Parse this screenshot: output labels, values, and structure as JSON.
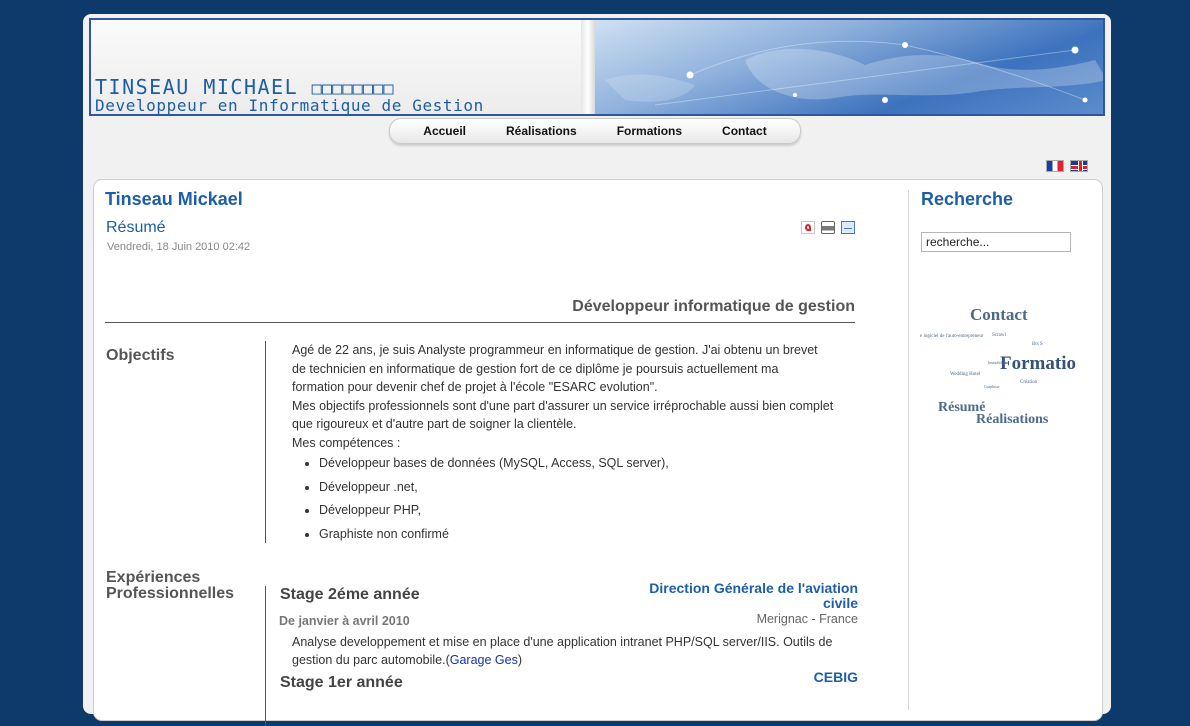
{
  "header": {
    "title": "TINSEAU MICHAEL",
    "title_boxes": "□□□□□□□□",
    "subtitle": "Developpeur en Informatique de Gestion"
  },
  "nav": {
    "items": [
      "Accueil",
      "Réalisations",
      "Formations",
      "Contact"
    ]
  },
  "languages": {
    "fr_icon": "french-flag-icon",
    "en_icon": "english-flag-icon"
  },
  "article": {
    "author": "Tinseau Mickael",
    "title": "Résumé",
    "date": "Vendredi, 18 Juin 2010 02:42",
    "icons": [
      "pdf-icon",
      "print-icon",
      "email-icon"
    ],
    "subheading": "Développeur informatique de gestion",
    "objectives": {
      "label": "Objectifs",
      "lines": [
        "Agé de 22 ans, je suis Analyste programmeur en informatique de gestion. J'ai obtenu un brevet",
        "de technicien en informatique de gestion fort de ce diplôme je poursuis actuellement ma",
        "formation pour devenir chef de projet à l'école \"ESARC evolution\".",
        "Mes objectifs professionnels sont d'une part d'assurer un service irréprochable aussi bien complet",
        "que rigoureux  et d'autre part de soigner la clientèle.",
        "Mes compétences :"
      ],
      "skills": [
        "Développeur bases de données (MySQL, Access, SQL server),",
        "Développeur .net,",
        "Développeur PHP,",
        "Graphiste non confirmé"
      ]
    },
    "experience": {
      "label_line1": "Expériences",
      "label_line2": "Professionnelles",
      "jobs": [
        {
          "title": "Stage 2éme année",
          "company_line1": "Direction Générale de l'aviation",
          "company_line2": "civile",
          "place": "Merignac - France",
          "period": "De janvier à avril 2010",
          "desc_line1": "Analyse developpement et mise en place d'une application intranet PHP/SQL server/IIS. Outils de",
          "desc_line2": "gestion du parc automobile.(",
          "desc_link": "Garage Ges",
          "desc_end": ")"
        },
        {
          "title": "Stage 1er année",
          "company_line1": "CEBIG"
        }
      ]
    }
  },
  "sidebar": {
    "search_title": "Recherche",
    "search_value": "recherche...",
    "tags": [
      "Contact",
      "Formatio",
      "Résumé",
      "Réalisations",
      "e logiciel de l'auto-entrepreneur",
      "Bts S",
      "Wedding Hotel",
      "Graphiste",
      "Scrawl",
      "Immobilier",
      "Création"
    ]
  }
}
